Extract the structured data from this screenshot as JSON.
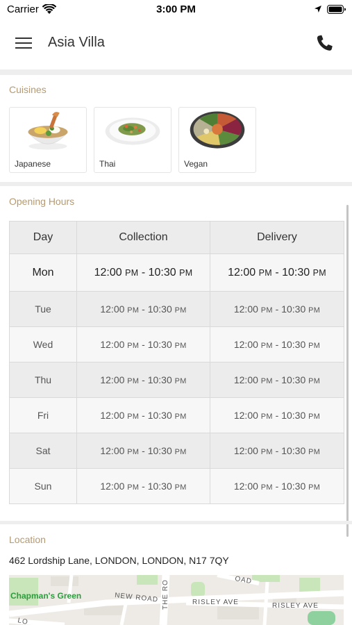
{
  "status_bar": {
    "carrier": "Carrier",
    "time": "3:00 PM"
  },
  "header": {
    "title": "Asia Villa",
    "menu_icon": "hamburger-menu-icon",
    "phone_icon": "phone-icon"
  },
  "cuisines": {
    "title": "Cuisines",
    "items": [
      {
        "label": "Japanese",
        "image": "ramen-bowl-image"
      },
      {
        "label": "Thai",
        "image": "noodle-plate-image"
      },
      {
        "label": "Vegan",
        "image": "veggie-bowl-image"
      }
    ]
  },
  "opening_hours": {
    "title": "Opening Hours",
    "headers": [
      "Day",
      "Collection",
      "Delivery"
    ],
    "rows": [
      {
        "day": "Mon",
        "collection": {
          "open": "12:00",
          "open_ampm": "PM",
          "close": "10:30",
          "close_ampm": "PM"
        },
        "delivery": {
          "open": "12:00",
          "open_ampm": "PM",
          "close": "10:30",
          "close_ampm": "PM"
        }
      },
      {
        "day": "Tue",
        "collection": {
          "open": "12:00",
          "open_ampm": "PM",
          "close": "10:30",
          "close_ampm": "PM"
        },
        "delivery": {
          "open": "12:00",
          "open_ampm": "PM",
          "close": "10:30",
          "close_ampm": "PM"
        }
      },
      {
        "day": "Wed",
        "collection": {
          "open": "12:00",
          "open_ampm": "PM",
          "close": "10:30",
          "close_ampm": "PM"
        },
        "delivery": {
          "open": "12:00",
          "open_ampm": "PM",
          "close": "10:30",
          "close_ampm": "PM"
        }
      },
      {
        "day": "Thu",
        "collection": {
          "open": "12:00",
          "open_ampm": "PM",
          "close": "10:30",
          "close_ampm": "PM"
        },
        "delivery": {
          "open": "12:00",
          "open_ampm": "PM",
          "close": "10:30",
          "close_ampm": "PM"
        }
      },
      {
        "day": "Fri",
        "collection": {
          "open": "12:00",
          "open_ampm": "PM",
          "close": "10:30",
          "close_ampm": "PM"
        },
        "delivery": {
          "open": "12:00",
          "open_ampm": "PM",
          "close": "10:30",
          "close_ampm": "PM"
        }
      },
      {
        "day": "Sat",
        "collection": {
          "open": "12:00",
          "open_ampm": "PM",
          "close": "10:30",
          "close_ampm": "PM"
        },
        "delivery": {
          "open": "12:00",
          "open_ampm": "PM",
          "close": "10:30",
          "close_ampm": "PM"
        }
      },
      {
        "day": "Sun",
        "collection": {
          "open": "12:00",
          "open_ampm": "PM",
          "close": "10:30",
          "close_ampm": "PM"
        },
        "delivery": {
          "open": "12:00",
          "open_ampm": "PM",
          "close": "10:30",
          "close_ampm": "PM"
        }
      }
    ]
  },
  "location": {
    "title": "Location",
    "address": "462 Lordship Lane, LONDON, LONDON, N17 7QY",
    "map_labels": {
      "area": "Chapman's Green",
      "road_1": "NEW ROAD",
      "road_2": "THE RO",
      "road_3": "RISLEY AVE",
      "road_4": "RISLEY AVE",
      "road_5": "LO",
      "road_6": "OAD"
    }
  },
  "colors": {
    "section_title": "#b59a72",
    "map_green_label": "#2e9a3e"
  }
}
